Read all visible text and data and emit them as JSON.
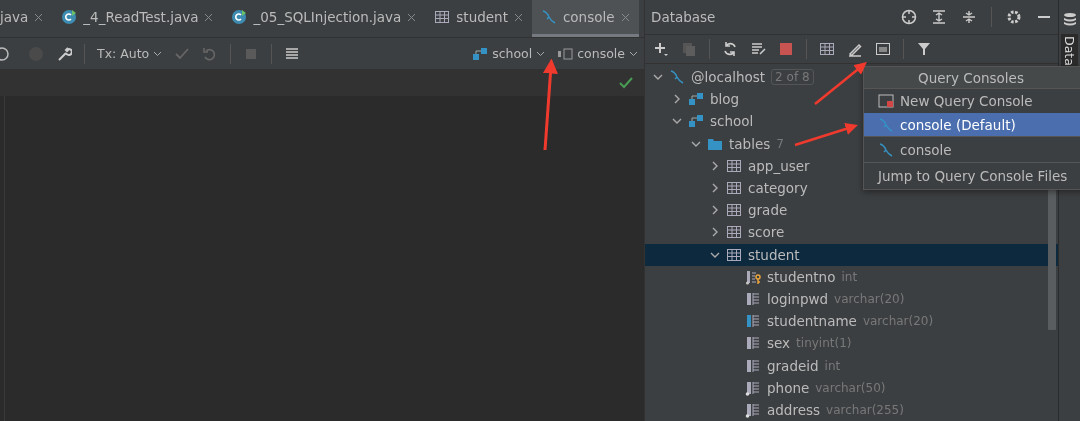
{
  "editor_tabs": [
    {
      "label": "java",
      "kind": "none",
      "selected": false
    },
    {
      "label": "_4_ReadTest.java",
      "kind": "class",
      "selected": false
    },
    {
      "label": "_05_SQLInjection.java",
      "kind": "class",
      "selected": false
    },
    {
      "label": "student",
      "kind": "table",
      "selected": false
    },
    {
      "label": "console",
      "kind": "console",
      "selected": true
    }
  ],
  "editor_toolbar": {
    "transaction": "Tx: Auto",
    "schema": "school",
    "session": "console"
  },
  "database_panel": {
    "title": "Database",
    "tree": [
      {
        "label": "@localhost",
        "kind": "host",
        "badge": "2 of 8",
        "expanded": true,
        "selected": false,
        "children": [
          {
            "label": "blog",
            "kind": "schema",
            "expanded": false,
            "selected": false
          },
          {
            "label": "school",
            "kind": "schema",
            "expanded": true,
            "selected": false,
            "children": [
              {
                "label": "tables",
                "kind": "folder",
                "count": "7",
                "expanded": true,
                "selected": false,
                "children": [
                  {
                    "label": "app_user",
                    "kind": "table",
                    "expanded": false,
                    "selected": false
                  },
                  {
                    "label": "category",
                    "kind": "table",
                    "expanded": false,
                    "selected": false
                  },
                  {
                    "label": "grade",
                    "kind": "table",
                    "expanded": false,
                    "selected": false
                  },
                  {
                    "label": "score",
                    "kind": "table",
                    "expanded": false,
                    "selected": false
                  },
                  {
                    "label": "student",
                    "kind": "table",
                    "expanded": true,
                    "selected": true,
                    "children": [
                      {
                        "label": "studentno",
                        "kind": "key-column",
                        "type": "int",
                        "selected": false
                      },
                      {
                        "label": "loginpwd",
                        "kind": "column",
                        "type": "varchar(20)",
                        "selected": false
                      },
                      {
                        "label": "studentname",
                        "kind": "indexed-column",
                        "type": "varchar(20)",
                        "selected": false
                      },
                      {
                        "label": "sex",
                        "kind": "column",
                        "type": "tinyint(1)",
                        "selected": false
                      },
                      {
                        "label": "gradeid",
                        "kind": "column",
                        "type": "int",
                        "selected": false
                      },
                      {
                        "label": "phone",
                        "kind": "required-column",
                        "type": "varchar(50)",
                        "selected": false
                      },
                      {
                        "label": "address",
                        "kind": "required-column",
                        "type": "varchar(255)",
                        "selected": false
                      }
                    ]
                  }
                ]
              }
            ]
          }
        ]
      }
    ]
  },
  "query_consoles_popup": {
    "title": "Query Consoles",
    "items": [
      {
        "label": "New Query Console",
        "kind": "new",
        "selected": false
      },
      {
        "label": "console (Default)",
        "kind": "console",
        "selected": true
      },
      {
        "label": "console",
        "kind": "console",
        "selected": false
      },
      {
        "label": "Jump to Query Console Files",
        "kind": "link",
        "selected": false
      }
    ]
  },
  "side_strip": {
    "label": "Data"
  }
}
